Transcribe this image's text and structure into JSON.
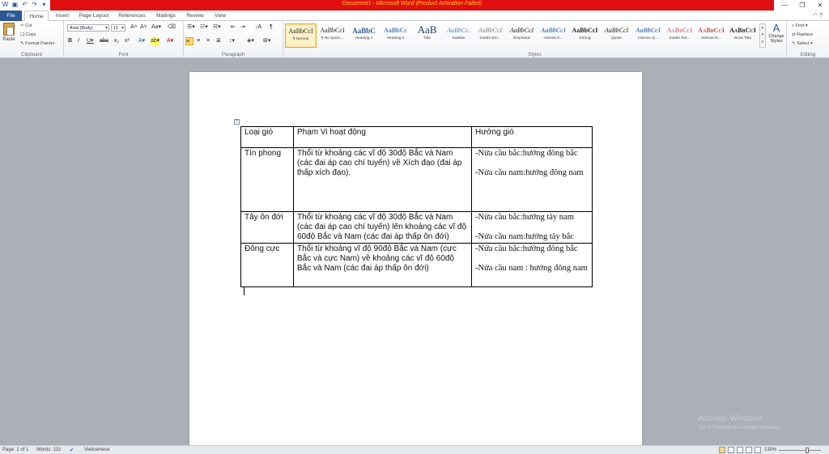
{
  "window": {
    "title": "Document1 - Microsoft Word (Product Activation Failed)"
  },
  "qat_icons": [
    "word-icon",
    "save-icon",
    "undo-icon",
    "redo-icon",
    "customize-icon"
  ],
  "tabs": [
    "File",
    "Home",
    "Insert",
    "Page Layout",
    "References",
    "Mailings",
    "Review",
    "View"
  ],
  "clipboard": {
    "paste": "Paste",
    "cut": "Cut",
    "copy": "Copy",
    "format_painter": "Format Painter",
    "label": "Clipboard"
  },
  "font": {
    "name": "Arial (Body)",
    "size": "11",
    "label": "Font"
  },
  "paragraph": {
    "label": "Paragraph"
  },
  "styles": {
    "label": "Styles",
    "items": [
      {
        "sample": "AaBbCcI",
        "name": "¶ Normal"
      },
      {
        "sample": "AaBbCcI",
        "name": "¶ No Spaci..."
      },
      {
        "sample": "AaBbC",
        "name": "Heading 1"
      },
      {
        "sample": "AaBbCc",
        "name": "Heading 2"
      },
      {
        "sample": "AaB",
        "name": "Title"
      },
      {
        "sample": "AaBbCc.",
        "name": "Subtitle"
      },
      {
        "sample": "AaBbCcI",
        "name": "Subtle Em..."
      },
      {
        "sample": "AaBbCcI",
        "name": "Emphasis"
      },
      {
        "sample": "AaBbCcI",
        "name": "Intense E..."
      },
      {
        "sample": "AaBbCcI",
        "name": "Strong"
      },
      {
        "sample": "AaBbCcI",
        "name": "Quote"
      },
      {
        "sample": "AaBbCcI",
        "name": "Intense Q..."
      },
      {
        "sample": "AaBbCcI",
        "name": "Subtle Ref..."
      },
      {
        "sample": "AaBbCcI",
        "name": "Intense R..."
      },
      {
        "sample": "AaBbCcI",
        "name": "Book Title"
      }
    ],
    "change_styles": "Change Styles"
  },
  "editing": {
    "find": "Find",
    "replace": "Replace",
    "select": "Select",
    "label": "Editing"
  },
  "table": {
    "headers": [
      "Loại gió",
      "Phạm Vi hoạt động",
      "Hướng gió"
    ],
    "rows": [
      {
        "type": "Tín phong",
        "range": "Thổi từ khoảng các vĩ độ 30độ Bắc và Nam (các đai áp cao chí tuyến) về Xích đạo (đai áp thấp xích đạo).",
        "dir1": "-Nửa cầu bắc:hướng đông bắc",
        "dir2": "-Nửa cầu nam:hướng đông nam"
      },
      {
        "type": "Tây ôn đới",
        "range": "Thổi từ khoảng các vĩ độ 30độ Bắc và Nam (các đai áp cao chí tuyến) lên khoảng các vĩ độ 60độ Bắc và Nam (các đai áp thấp ôn đới)",
        "dir1": "-Nửa cầu bắc:hướng tây nam",
        "dir2": "-Nửa cầu nam:hướng tây bắc"
      },
      {
        "type": "Đông cực",
        "range": "Thổi từ khoảng vĩ độ 90độ Bắc và Nam (cực Bắc và cực Nam) về khoảng các vĩ độ 60độ Bắc và Nam (các đai áp thấp ôn đới)",
        "dir1": "-Nửa cầu bắc:hướng đông bắc",
        "dir2": "-Nửa cầu nam : hướng đông nam"
      }
    ]
  },
  "watermark": {
    "line1": "Activate Windows",
    "line2": "Go to Settings to activate Windows."
  },
  "status": {
    "page": "Page: 1 of 1",
    "words": "Words: 131",
    "language": "Vietnamese",
    "zoom": "130%"
  }
}
